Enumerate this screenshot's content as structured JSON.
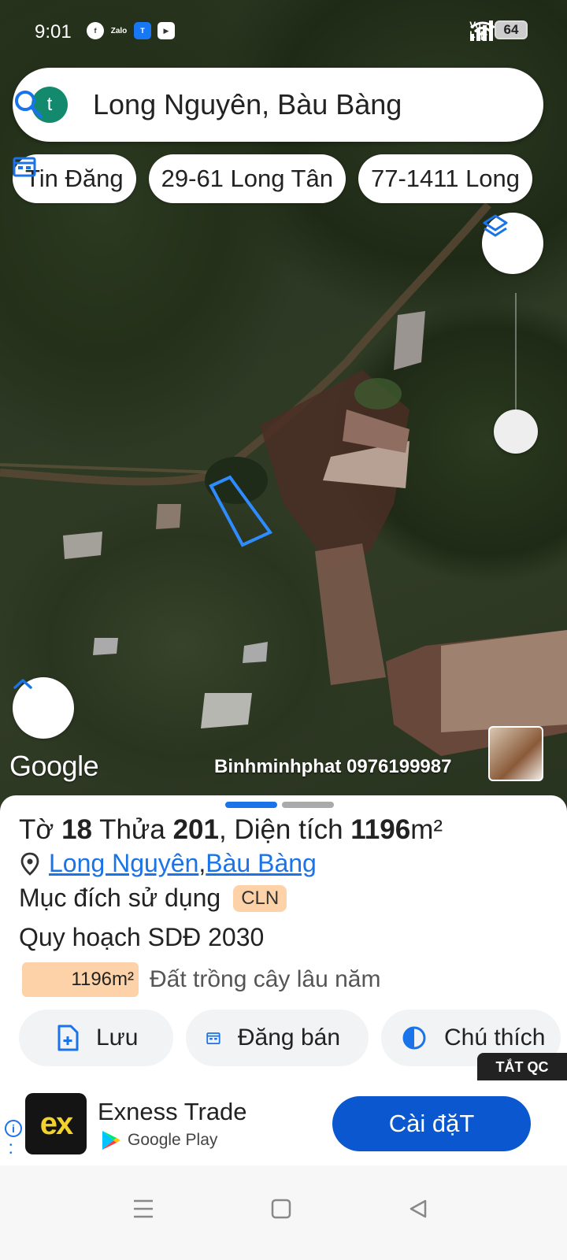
{
  "status_bar": {
    "time": "9:01",
    "battery": "64"
  },
  "search": {
    "avatar_letter": "t",
    "query": "Long Nguyên, Bàu Bàng"
  },
  "chips": [
    {
      "label": "Tin Đăng"
    },
    {
      "label": "29-61 Long Tân"
    },
    {
      "label": "77-1411 Long"
    }
  ],
  "map": {
    "attribution": "Google",
    "watermark": "Binhminhphat   0976199987"
  },
  "sheet": {
    "title": {
      "prefix": "Tờ ",
      "sheet_no": "18",
      "mid1": " Thửa ",
      "parcel_no": "201",
      "mid2": ", Diện tích ",
      "area": "1196",
      "unit": "m²"
    },
    "location": {
      "commune": "Long Nguyên",
      "separator": ", ",
      "district": "Bàu Bàng"
    },
    "purpose": {
      "label": "Mục đích sử dụng",
      "code": "CLN"
    },
    "plan_label": "Quy hoạch SDĐ 2030",
    "legend": {
      "area": "1196m²",
      "description": "Đất trồng cây lâu năm"
    },
    "actions": [
      {
        "label": "Lưu"
      },
      {
        "label": "Đăng bán"
      },
      {
        "label": "Chú thích"
      }
    ],
    "ad_off_label": "TẮT QC"
  },
  "ad": {
    "logo_text": "ex",
    "app_name": "Exness Trade",
    "store": "Google Play",
    "install_label": "Cài đặT"
  },
  "colors": {
    "accent": "#1a73e8",
    "install": "#0b57d0",
    "badge": "#fdd2a8",
    "parcel_outline": "#2f8cff"
  }
}
